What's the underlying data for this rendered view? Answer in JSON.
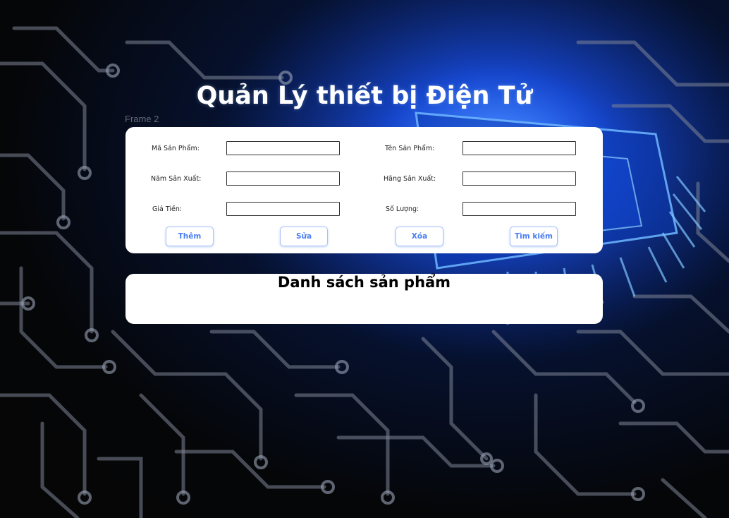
{
  "page": {
    "title": "Quản Lý thiết bị Điện Tử",
    "frame_label": "Frame 2"
  },
  "form": {
    "fields": [
      {
        "label": "Mã Sản Phẩm:",
        "value": ""
      },
      {
        "label": "Tên Sản Phẩm:",
        "value": ""
      },
      {
        "label": "Năm Sản Xuất:",
        "value": ""
      },
      {
        "label": "Hãng Sản Xuất:",
        "value": ""
      },
      {
        "label": "Giá Tiền:",
        "value": ""
      },
      {
        "label": "Số Lượng:",
        "value": ""
      }
    ],
    "buttons": {
      "add": "Thêm",
      "edit": "Sửa",
      "delete": "Xóa",
      "search": "Tìm kiếm"
    }
  },
  "list": {
    "title": "Danh sách sản phẩm"
  },
  "colors": {
    "button_text": "#4a7ef3",
    "button_border": "#a9c1f5",
    "card_background": "#ffffff",
    "circuit_glow": "#1f5dff"
  },
  "background": {
    "image": "circuit-board-chip"
  }
}
